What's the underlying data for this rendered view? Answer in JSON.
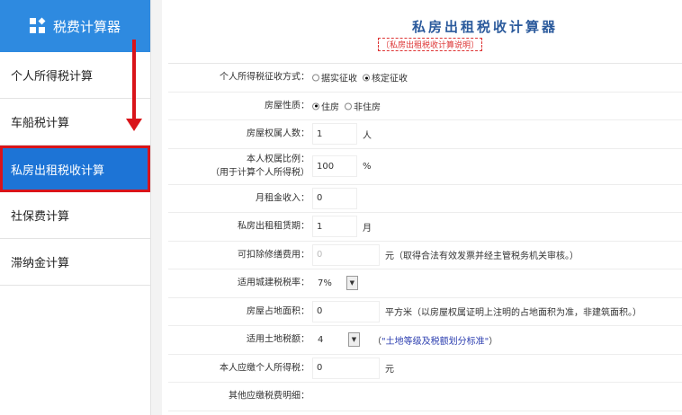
{
  "sidebar": {
    "title": "税费计算器",
    "items": [
      "个人所得税计算",
      "车船税计算",
      "私房出租税收计算",
      "社保费计算",
      "滞纳金计算"
    ],
    "active_index": 2
  },
  "page": {
    "title": "私房出租税收计算器",
    "explain_link": "〔私房出租税收计算说明〕"
  },
  "form": {
    "collection_method": {
      "label": "个人所得税征收方式：",
      "options": [
        "据实征收",
        "核定征收"
      ],
      "selected": "核定征收"
    },
    "house_type": {
      "label": "房屋性质：",
      "options": [
        "住房",
        "非住房"
      ],
      "selected": "住房"
    },
    "owners": {
      "label": "房屋权属人数：",
      "value": "1",
      "unit": "人"
    },
    "share": {
      "label": "本人权属比例：",
      "sublabel": "（用于计算个人所得税）",
      "value": "100",
      "unit": "%"
    },
    "monthly_rent": {
      "label": "月租金收入：",
      "value": "0"
    },
    "lease_term": {
      "label": "私房出租租赁期：",
      "value": "1",
      "unit": "月"
    },
    "repair_cost": {
      "label": "可扣除修缮费用：",
      "value": "0",
      "unit": "元（取得合法有效发票并经主管税务机关审核。）"
    },
    "city_tax_rate": {
      "label": "适用城建税税率：",
      "value": "7%"
    },
    "land_area": {
      "label": "房屋占地面积：",
      "value": "0",
      "unit": "平方米（以房屋权属证明上注明的占地面积为准，非建筑面积。）"
    },
    "land_tax": {
      "label": "适用土地税额：",
      "value": "4",
      "link_prefix": "（",
      "link": "\"土地等级及税额划分标准\"",
      "link_suffix": "）"
    },
    "income_tax": {
      "label": "本人应缴个人所得税：",
      "value": "0",
      "unit": "元"
    },
    "other_taxes": {
      "label": "其他应缴税费明细："
    }
  }
}
